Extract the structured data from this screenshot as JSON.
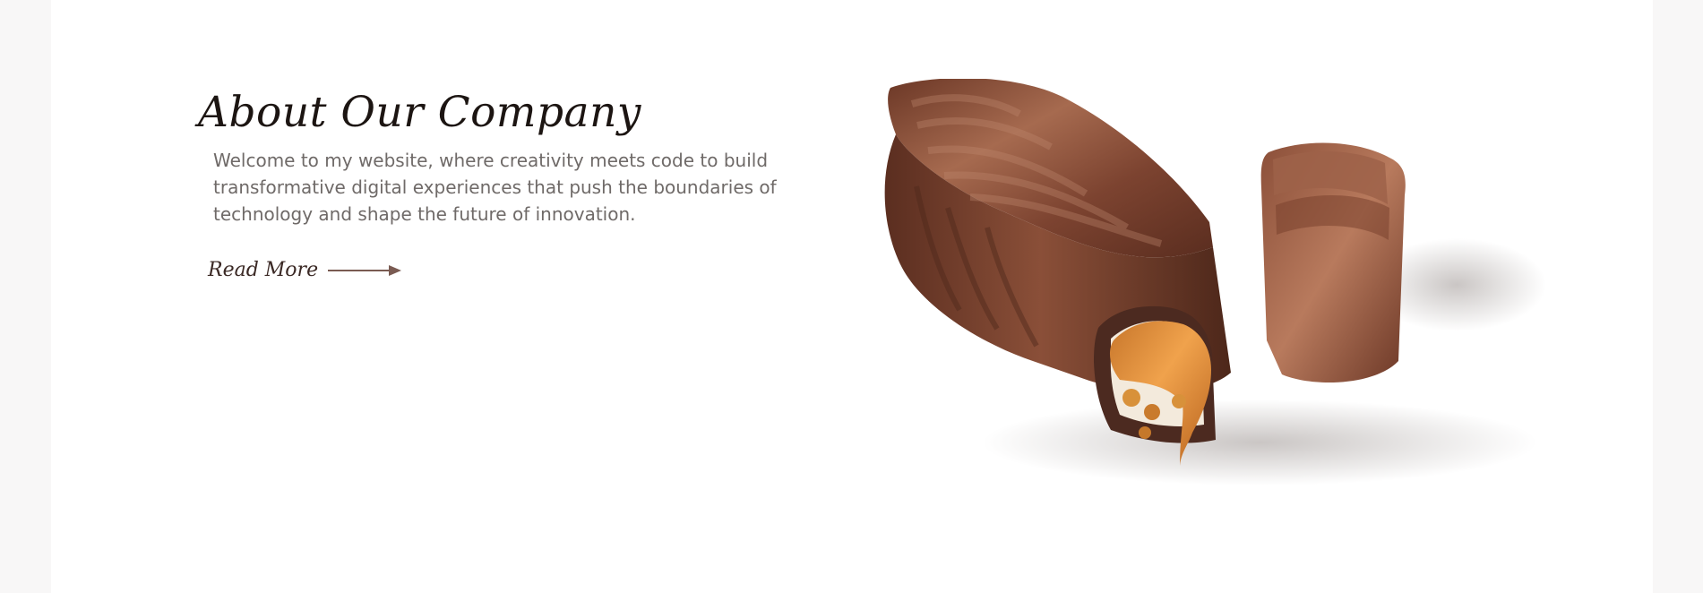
{
  "about": {
    "title": "About Our Company",
    "description": "Welcome to my website, where creativity meets code to build transformative digital experiences that push the boundaries of technology and shape the future of innovation.",
    "read_more_label": "Read More",
    "arrow_icon": "arrow-right-icon"
  },
  "product_image": {
    "subject": "chocolate caramel bar"
  },
  "colors": {
    "title": "#1c1512",
    "body_text": "#6f6a68",
    "accent": "#7a5b52",
    "chocolate_dark": "#5e3325",
    "chocolate_mid": "#8b4f39",
    "caramel": "#d68a35",
    "nougat": "#f3eadc"
  }
}
